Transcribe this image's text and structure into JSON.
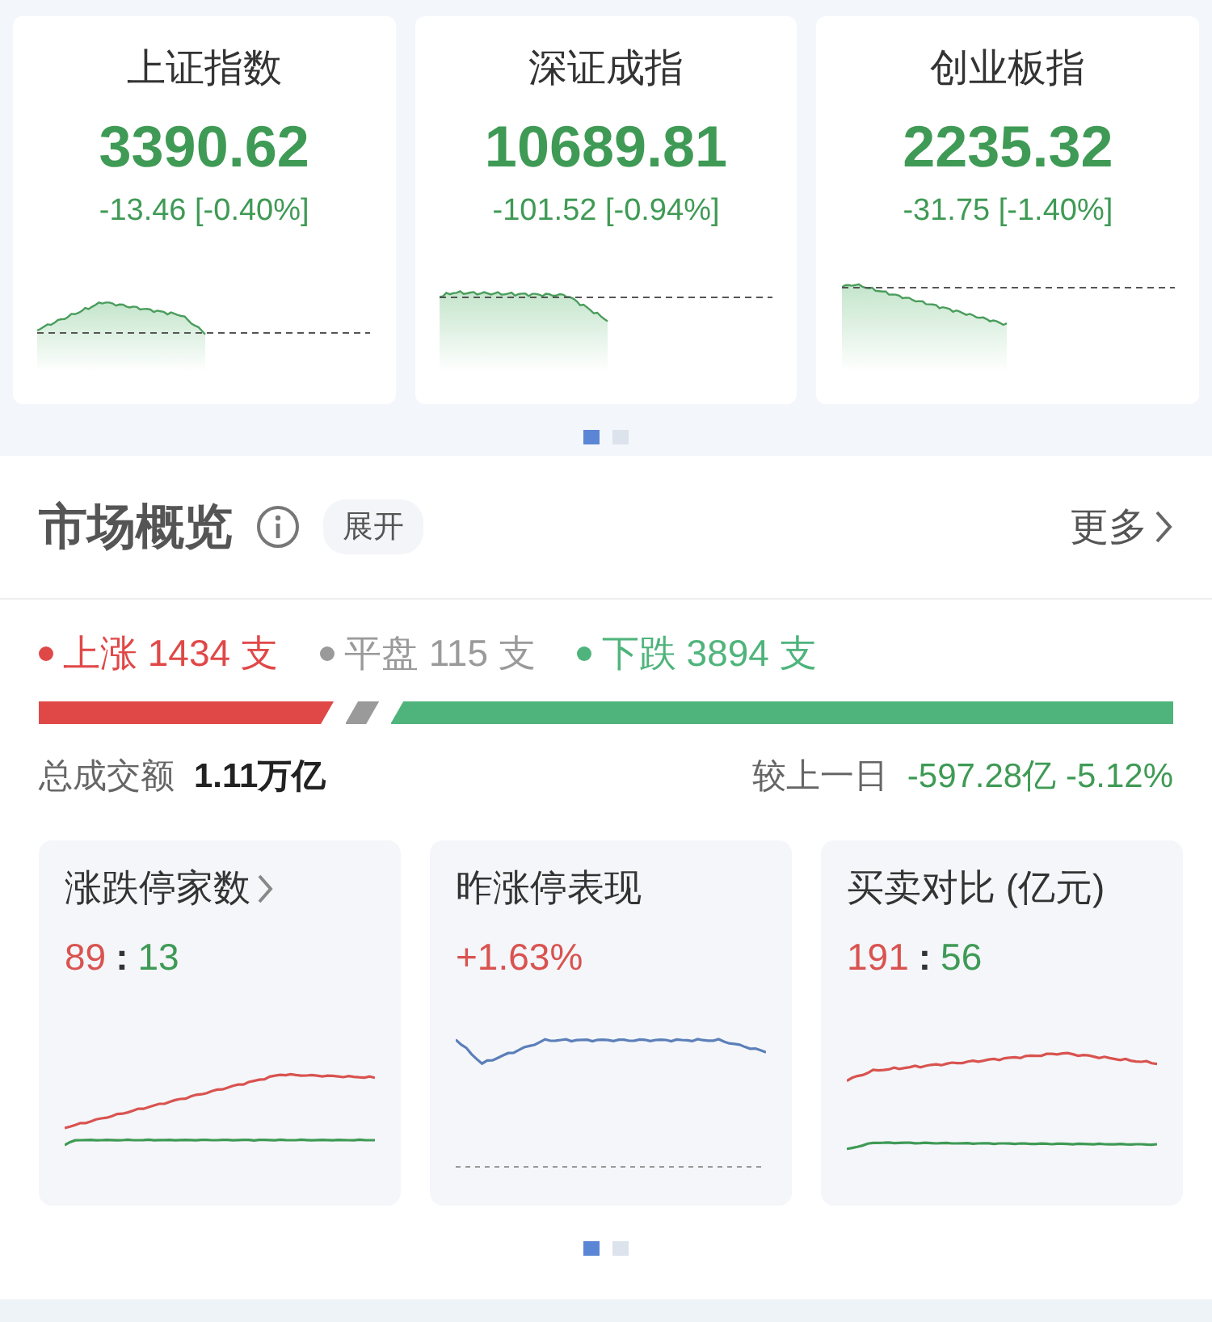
{
  "indices": [
    {
      "name": "上证指数",
      "value": "3390.62",
      "change": "-13.46 [-0.40%]"
    },
    {
      "name": "深证成指",
      "value": "10689.81",
      "change": "-101.52 [-0.94%]"
    },
    {
      "name": "创业板指",
      "value": "2235.32",
      "change": "-31.75 [-1.40%]"
    }
  ],
  "index_pager": [
    {
      "selected": true
    },
    {
      "selected": false
    }
  ],
  "market": {
    "title": "市场概览",
    "expand_label": "展开",
    "more_label": "更多",
    "breadth": [
      {
        "label": "上涨 1434 支",
        "color": "#e04848"
      },
      {
        "label": "平盘 115 支",
        "color": "#9a9a9a"
      },
      {
        "label": "下跌 3894 支",
        "color": "#4fb47c"
      }
    ],
    "turnover_label": "总成交额",
    "turnover_value": "1.11万亿",
    "compare_label": "较上一日",
    "compare_value": "-597.28亿 -5.12%"
  },
  "stat_cards": [
    {
      "title": "涨跌停家数",
      "has_arrow": true,
      "kind": "ratio",
      "up": "89",
      "separator": ":",
      "down": "13"
    },
    {
      "title": "昨涨停表现",
      "has_arrow": false,
      "kind": "percent",
      "value": "+1.63%"
    },
    {
      "title": "买卖对比 (亿元)",
      "has_arrow": false,
      "kind": "ratio",
      "up": "191",
      "separator": ":",
      "down": "56"
    }
  ],
  "stat_pager": [
    {
      "selected": true
    },
    {
      "selected": false
    }
  ]
}
